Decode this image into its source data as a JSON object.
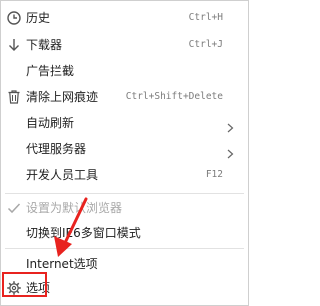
{
  "menu": {
    "items": [
      {
        "label": "历史",
        "shortcut": "Ctrl+H",
        "icon": "history-clock-icon"
      },
      {
        "label": "下载器",
        "shortcut": "Ctrl+J",
        "icon": "download-arrow-icon"
      },
      {
        "label": "广告拦截"
      },
      {
        "label": "清除上网痕迹",
        "shortcut": "Ctrl+Shift+Delete",
        "icon": "trash-icon"
      },
      {
        "label": "自动刷新",
        "submenu": true
      },
      {
        "label": "代理服务器",
        "submenu": true
      },
      {
        "label": "开发人员工具",
        "shortcut": "F12"
      },
      {
        "label": "设置为默认浏览器",
        "disabled": true,
        "icon": "checkmark-icon"
      },
      {
        "label": "切换到IE6多窗口模式"
      },
      {
        "label": "Internet选项"
      },
      {
        "label": "选项",
        "icon": "gear-icon"
      }
    ]
  },
  "annotation": {
    "color": "#e8231f"
  }
}
